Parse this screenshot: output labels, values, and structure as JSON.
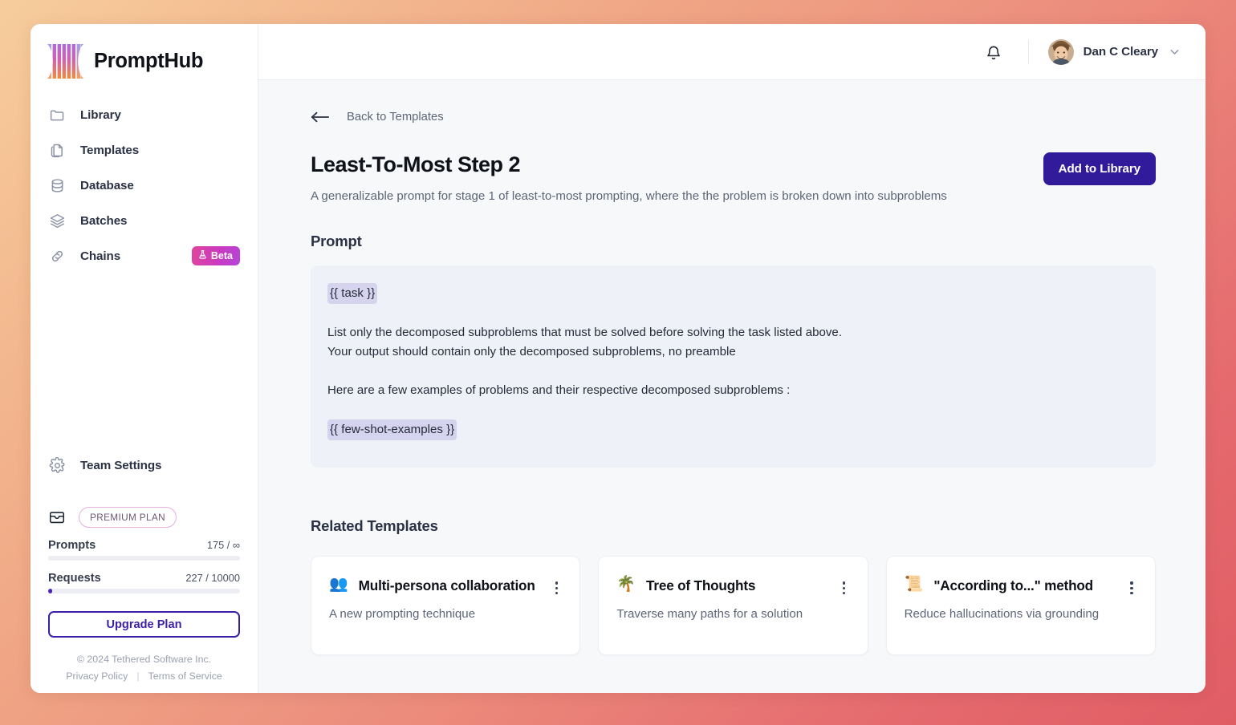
{
  "brand": {
    "name": "PromptHub",
    "logo_icon": "prompthub-bars-logo"
  },
  "sidebar": {
    "items": [
      {
        "label": "Library",
        "icon": "folder-icon"
      },
      {
        "label": "Templates",
        "icon": "documents-icon"
      },
      {
        "label": "Database",
        "icon": "database-icon"
      },
      {
        "label": "Batches",
        "icon": "layers-icon"
      },
      {
        "label": "Chains",
        "icon": "link-icon",
        "badge": "Beta",
        "badge_icon": "flask-icon"
      }
    ],
    "team_settings": {
      "label": "Team Settings",
      "icon": "gear-icon"
    },
    "plan": {
      "icon": "wallet-icon",
      "pill": "PREMIUM PLAN",
      "meters": [
        {
          "name": "Prompts",
          "value": "175 / ∞",
          "percent": 0
        },
        {
          "name": "Requests",
          "value": "227 / 10000",
          "percent": 2.3
        }
      ],
      "upgrade_label": "Upgrade Plan"
    },
    "legal": {
      "copyright": "© 2024 Tethered Software Inc.",
      "privacy": "Privacy Policy",
      "separator": "|",
      "terms": "Terms of Service"
    }
  },
  "topbar": {
    "bell_icon": "notification-bell-icon",
    "user_name": "Dan C Cleary",
    "chevron_icon": "chevron-down-icon",
    "avatar_icon": "user-avatar"
  },
  "main": {
    "back_label": "Back to Templates",
    "back_icon": "arrow-left-icon",
    "title": "Least-To-Most Step 2",
    "subtitle": "A generalizable prompt for stage 1 of least-to-most prompting, where the the problem is broken down into subproblems",
    "add_to_library_label": "Add to Library",
    "prompt_section_title": "Prompt",
    "prompt": {
      "var_1": "{{ task }}",
      "line_1": "List only the decomposed subproblems that must be solved before solving the task listed above.",
      "line_2": "Your output should contain only the decomposed subproblems, no preamble",
      "line_3": "Here are a few examples of problems and their respective decomposed subproblems :",
      "var_2": "{{ few-shot-examples }}"
    },
    "related_title": "Related Templates",
    "related_cards": [
      {
        "emoji": "👥",
        "emoji_name": "people-emoji",
        "name": "Multi-persona collaboration",
        "desc": "A new prompting technique"
      },
      {
        "emoji": "🌴",
        "emoji_name": "palm-tree-emoji",
        "name": "Tree of Thoughts",
        "desc": "Traverse many paths for a solution"
      },
      {
        "emoji": "📜",
        "emoji_name": "scroll-emoji",
        "name": "\"According to...\" method",
        "desc": "Reduce hallucinations via grounding"
      }
    ]
  },
  "colors": {
    "primary": "#311b9b",
    "accent_purple": "#4a22bf",
    "badge_gradient_start": "#e0459b",
    "badge_gradient_end": "#b545d8",
    "variable_highlight": "#d5d3ee",
    "prompt_bg": "#eef1f7",
    "bg_gradient_start": "#f7cd9c",
    "bg_gradient_end": "#e05d64"
  }
}
